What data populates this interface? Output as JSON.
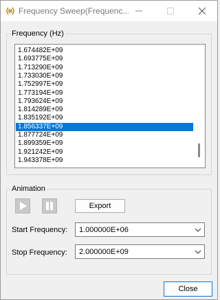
{
  "window": {
    "title": "Frequency Sweep(Frequenc..."
  },
  "frequency_group": {
    "label": "Frequency (Hz)",
    "items": [
      "1.674482E+09",
      "1.693775E+09",
      "1.713290E+09",
      "1.733030E+09",
      "1.752997E+09",
      "1.773194E+09",
      "1.793624E+09",
      "1.814289E+09",
      "1.835192E+09",
      "1.856337E+09",
      "1.877724E+09",
      "1.899359E+09",
      "1.921242E+09",
      "1.943378E+09"
    ],
    "selected_value": "1.856337E+09"
  },
  "animation_group": {
    "label": "Animation",
    "export_label": "Export",
    "start_label": "Start Frequency:",
    "start_value": "1.000000E+06",
    "stop_label": "Stop Frequency:",
    "stop_value": "2.000000E+09"
  },
  "footer": {
    "close_label": "Close"
  },
  "colors": {
    "selection": "#0078d7",
    "window_bg": "#f0f0f0"
  }
}
